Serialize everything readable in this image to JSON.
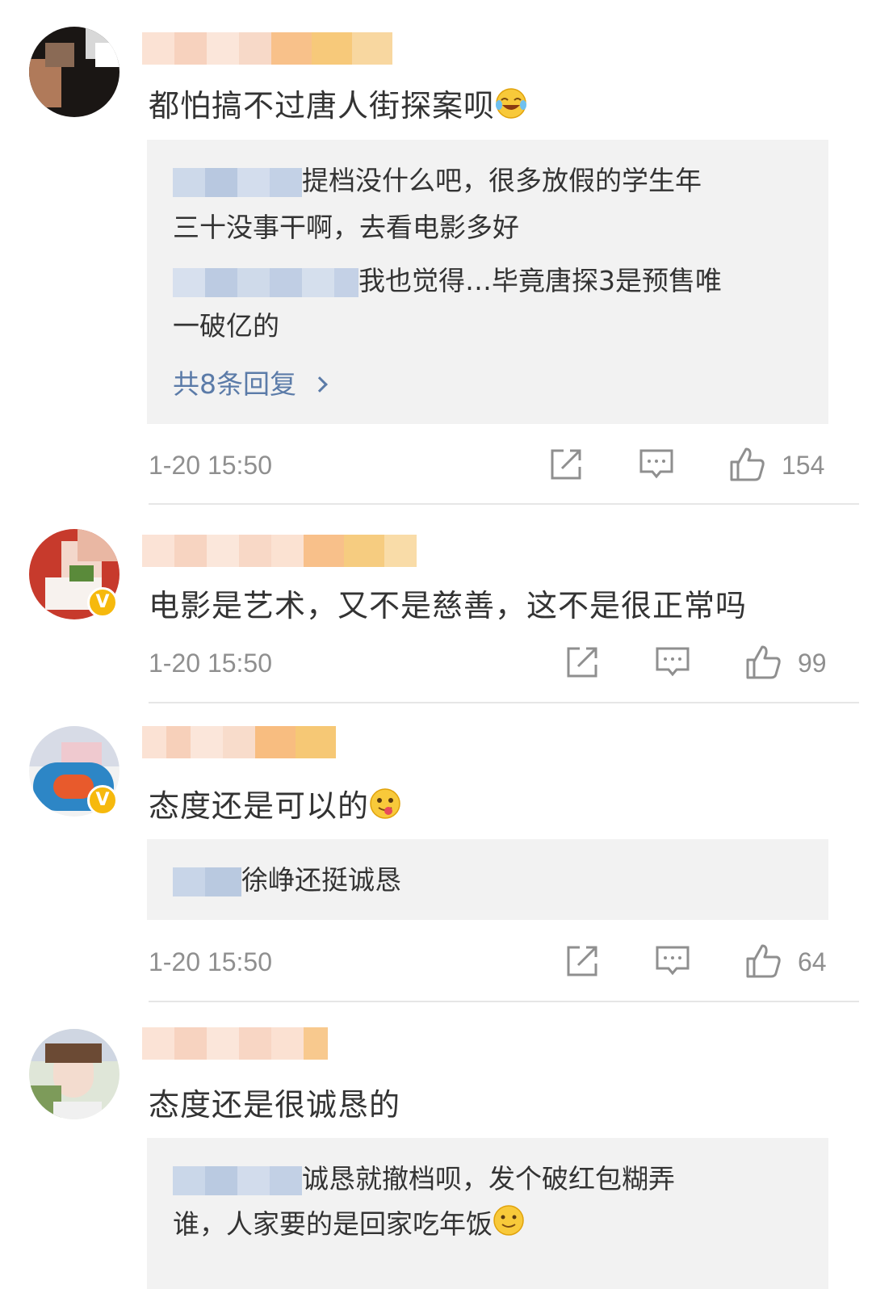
{
  "comments": [
    {
      "content": "都怕搞不过唐人街探案呗",
      "replies": [
        "提档没什么吧，很多放假的学生年",
        "三十没事干啊，去看电影多好",
        "我也觉得…毕竟唐探3是预售唯",
        "一破亿的"
      ],
      "more_replies_label": "共8条回复",
      "timestamp": "1-20 15:50",
      "likes": "154"
    },
    {
      "content": "电影是艺术，又不是慈善，这不是很正常吗",
      "timestamp": "1-20 15:50",
      "likes": "99"
    },
    {
      "content": "态度还是可以的",
      "replies": [
        "徐峥还挺诚恳"
      ],
      "timestamp": "1-20 15:50",
      "likes": "64"
    },
    {
      "content": "态度还是很诚恳的",
      "replies": [
        "诚恳就撤档呗，发个破红包糊弄",
        "谁，人家要的是回家吃年饭"
      ]
    }
  ],
  "icons": {
    "share": "share-icon",
    "comment": "comment-icon",
    "like": "thumbs-up-icon",
    "verified": "verified-badge-icon"
  },
  "colors": {
    "link": "#5b7ba8",
    "meta_text": "#8f8f8f",
    "reply_bg": "#f2f2f2",
    "verified_badge": "#f6b90d"
  }
}
